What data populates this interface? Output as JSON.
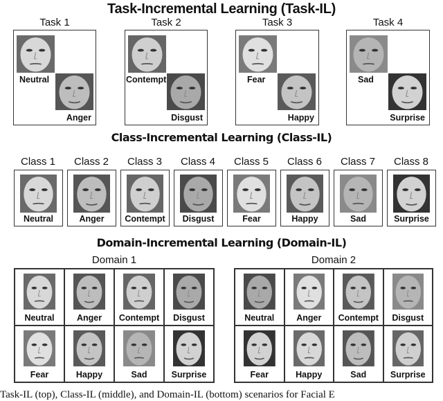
{
  "task_il": {
    "title": "Task-Incremental Learning (Task-IL)",
    "tasks": [
      {
        "label": "Task 1",
        "items": [
          "Neutral",
          "Anger"
        ]
      },
      {
        "label": "Task 2",
        "items": [
          "Contempt",
          "Disgust"
        ]
      },
      {
        "label": "Task 3",
        "items": [
          "Fear",
          "Happy"
        ]
      },
      {
        "label": "Task 4",
        "items": [
          "Sad",
          "Surprise"
        ]
      }
    ]
  },
  "class_il": {
    "title": "Class-Incremental Learning (Class-IL)",
    "classes": [
      {
        "label": "Class 1",
        "item": "Neutral"
      },
      {
        "label": "Class 2",
        "item": "Anger"
      },
      {
        "label": "Class 3",
        "item": "Contempt"
      },
      {
        "label": "Class 4",
        "item": "Disgust"
      },
      {
        "label": "Class 5",
        "item": "Fear"
      },
      {
        "label": "Class 6",
        "item": "Happy"
      },
      {
        "label": "Class 7",
        "item": "Sad"
      },
      {
        "label": "Class 8",
        "item": "Surprise"
      }
    ]
  },
  "domain_il": {
    "title": "Domain-Incremental Learning (Domain-IL)",
    "domains": [
      {
        "label": "Domain 1",
        "items": [
          "Neutral",
          "Anger",
          "Contempt",
          "Disgust",
          "Fear",
          "Happy",
          "Sad",
          "Surprise"
        ]
      },
      {
        "label": "Domain 2",
        "items": [
          "Neutral",
          "Anger",
          "Contempt",
          "Disgust",
          "Fear",
          "Happy",
          "Sad",
          "Surprise"
        ]
      }
    ]
  },
  "caption": "Task-IL (top), Class-IL (middle), and Domain-IL (bottom) scenarios for Facial E"
}
